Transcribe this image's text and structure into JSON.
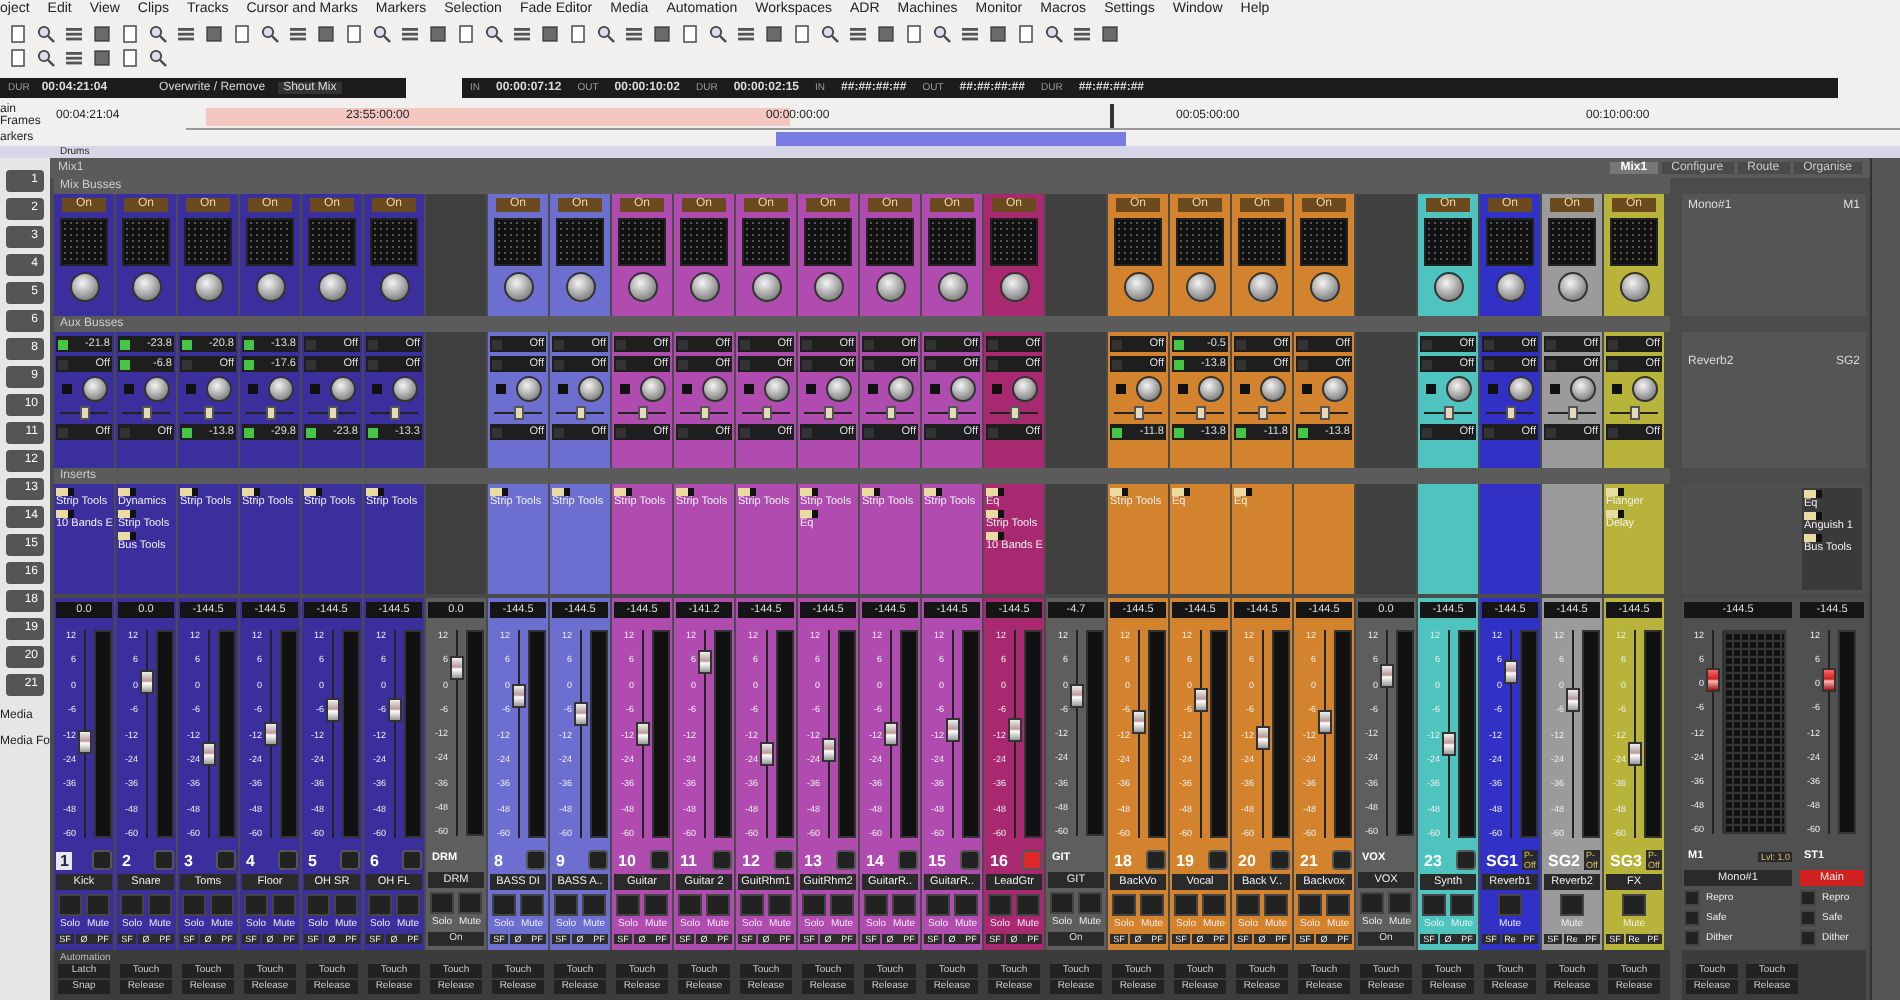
{
  "menu": [
    "oject",
    "Edit",
    "View",
    "Clips",
    "Tracks",
    "Cursor and Marks",
    "Markers",
    "Selection",
    "Fade Editor",
    "Media",
    "Automation",
    "Workspaces",
    "ADR",
    "Machines",
    "Monitor",
    "Macros",
    "Settings",
    "Window",
    "Help"
  ],
  "transport": {
    "duration_label": "DUR",
    "duration": "00:04:21:04",
    "mode": "Overwrite / Remove",
    "mix_button": "Shout Mix",
    "fields": [
      {
        "label": "IN",
        "value": "00:00:07:12"
      },
      {
        "label": "OUT",
        "value": "00:00:10:02"
      },
      {
        "label": "DUR",
        "value": "00:00:02:15"
      },
      {
        "label": "IN",
        "value": "##:##:##:##"
      },
      {
        "label": "OUT",
        "value": "##:##:##:##"
      },
      {
        "label": "DUR",
        "value": "##:##:##:##"
      }
    ]
  },
  "ruler": {
    "label": "ain Frames",
    "position": "00:04:21:04",
    "ticks": [
      "23:55:00:00",
      "00:00:00:00",
      "00:05:00:00",
      "00:10:00:00"
    ],
    "markers_label": "arkers",
    "track_label": "Drums"
  },
  "track_list": {
    "numbers": [
      "1",
      "2",
      "3",
      "4",
      "5",
      "6",
      "8",
      "9",
      "10",
      "11",
      "12",
      "13",
      "14",
      "15",
      "16",
      "18",
      "19",
      "20",
      "21"
    ],
    "media": [
      "Media",
      "Media Fo"
    ]
  },
  "mixer": {
    "title": "Mix1",
    "tabs": [
      {
        "label": "Mix1",
        "selected": true
      },
      {
        "label": "Configure",
        "selected": false
      },
      {
        "label": "Route",
        "selected": false
      },
      {
        "label": "Organise",
        "selected": false
      }
    ],
    "sections": [
      "Mix Busses",
      "Aux Busses",
      "Inserts",
      "Automation"
    ],
    "channels": [
      {
        "kind": "track",
        "number": "1",
        "name": "Kick",
        "color": "#3b2f9e",
        "selected": true,
        "armed": false,
        "bus": "On",
        "aux": [
          {
            "value": "-21.8",
            "on": true
          },
          {
            "value": "Off",
            "on": false
          },
          {
            "value": "Off",
            "on": false
          }
        ],
        "inserts": [
          "Strip Tools",
          "10 Bands E"
        ],
        "reading": "0.0",
        "level": 0.46,
        "scale": [
          "12",
          "6",
          "0",
          "-6",
          "-12",
          "-24",
          "-36",
          "-48",
          "-60"
        ],
        "buttons": [
          "Solo",
          "Mute"
        ],
        "flags": [
          "SF",
          "Ø",
          "PF"
        ],
        "auto": [
          "Latch",
          "Snap"
        ]
      },
      {
        "kind": "track",
        "number": "2",
        "name": "Snare",
        "color": "#3b2f9e",
        "selected": false,
        "armed": false,
        "bus": "On",
        "aux": [
          {
            "value": "-23.8",
            "on": true
          },
          {
            "value": "-6.8",
            "on": true
          },
          {
            "value": "Off",
            "on": false
          }
        ],
        "inserts": [
          "Dynamics",
          "Strip Tools",
          "Bus Tools"
        ],
        "reading": "0.0",
        "level": 0.75,
        "scale": [
          "12",
          "6",
          "0",
          "-6",
          "-12",
          "-24",
          "-36",
          "-48",
          "-60"
        ],
        "buttons": [
          "Solo",
          "Mute"
        ],
        "flags": [
          "SF",
          "Ø",
          "PF"
        ],
        "auto": [
          "Touch",
          "Release"
        ]
      },
      {
        "kind": "track",
        "number": "3",
        "name": "Toms",
        "color": "#3b2f9e",
        "selected": false,
        "armed": false,
        "bus": "On",
        "aux": [
          {
            "value": "-20.8",
            "on": true
          },
          {
            "value": "Off",
            "on": false
          },
          {
            "value": "-13.8",
            "on": true
          }
        ],
        "inserts": [
          "Strip Tools"
        ],
        "reading": "-144.5",
        "level": 0.4,
        "scale": [
          "12",
          "6",
          "0",
          "-6",
          "-12",
          "-24",
          "-36",
          "-48",
          "-60"
        ],
        "buttons": [
          "Solo",
          "Mute"
        ],
        "flags": [
          "SF",
          "Ø",
          "PF"
        ],
        "auto": [
          "Touch",
          "Release"
        ]
      },
      {
        "kind": "track",
        "number": "4",
        "name": "Floor",
        "color": "#3b2f9e",
        "selected": false,
        "armed": false,
        "bus": "On",
        "aux": [
          {
            "value": "-13.8",
            "on": true
          },
          {
            "value": "-17.6",
            "on": true
          },
          {
            "value": "-29.8",
            "on": true
          }
        ],
        "inserts": [
          "Strip Tools"
        ],
        "reading": "-144.5",
        "level": 0.5,
        "scale": [
          "12",
          "6",
          "0",
          "-6",
          "-12",
          "-24",
          "-36",
          "-48",
          "-60"
        ],
        "buttons": [
          "Solo",
          "Mute"
        ],
        "flags": [
          "SF",
          "Ø",
          "PF"
        ],
        "auto": [
          "Touch",
          "Release"
        ]
      },
      {
        "kind": "track",
        "number": "5",
        "name": "OH SR",
        "color": "#3b2f9e",
        "selected": false,
        "armed": false,
        "bus": "On",
        "aux": [
          {
            "value": "Off",
            "on": false
          },
          {
            "value": "Off",
            "on": false
          },
          {
            "value": "-23.8",
            "on": true
          }
        ],
        "inserts": [
          "Strip Tools"
        ],
        "reading": "-144.5",
        "level": 0.62,
        "scale": [
          "12",
          "6",
          "0",
          "-6",
          "-12",
          "-24",
          "-36",
          "-48",
          "-60"
        ],
        "buttons": [
          "Solo",
          "Mute"
        ],
        "flags": [
          "SF",
          "Ø",
          "PF"
        ],
        "auto": [
          "Touch",
          "Release"
        ]
      },
      {
        "kind": "track",
        "number": "6",
        "name": "OH FL",
        "color": "#3b2f9e",
        "selected": false,
        "armed": false,
        "bus": "On",
        "aux": [
          {
            "value": "Off",
            "on": false
          },
          {
            "value": "Off",
            "on": false
          },
          {
            "value": "-13.3",
            "on": true
          }
        ],
        "inserts": [
          "Strip Tools"
        ],
        "reading": "-144.5",
        "level": 0.62,
        "scale": [
          "12",
          "6",
          "0",
          "-6",
          "-12",
          "-24",
          "-36",
          "-48",
          "-60"
        ],
        "buttons": [
          "Solo",
          "Mute"
        ],
        "flags": [
          "SF",
          "Ø",
          "PF"
        ],
        "auto": [
          "Touch",
          "Release"
        ]
      },
      {
        "kind": "group",
        "number": "DRM",
        "name": "DRM",
        "color": "#5e5e5e",
        "selected": false,
        "reading": "0.0",
        "level": 0.82,
        "scale": [
          "12",
          "6",
          "0",
          "-6",
          "-12",
          "-24",
          "-36",
          "-48",
          "-60"
        ],
        "buttons": [
          "Solo",
          "Mute"
        ],
        "state": "On",
        "auto": [
          "Touch",
          "Release"
        ]
      },
      {
        "kind": "track",
        "number": "8",
        "name": "BASS DI",
        "color": "#6c6fd0",
        "selected": false,
        "armed": false,
        "bus": "On",
        "aux": [
          {
            "value": "Off",
            "on": false
          },
          {
            "value": "Off",
            "on": false
          },
          {
            "value": "Off",
            "on": false
          }
        ],
        "inserts": [
          "Strip Tools"
        ],
        "reading": "-144.5",
        "level": 0.68,
        "scale": [
          "12",
          "6",
          "0",
          "-6",
          "-12",
          "-24",
          "-36",
          "-48",
          "-60"
        ],
        "buttons": [
          "Solo",
          "Mute"
        ],
        "flags": [
          "SF",
          "Ø",
          "PF"
        ],
        "auto": [
          "Touch",
          "Release"
        ]
      },
      {
        "kind": "track",
        "number": "9",
        "name": "BASS A..",
        "color": "#6c6fd0",
        "selected": false,
        "armed": false,
        "bus": "On",
        "aux": [
          {
            "value": "Off",
            "on": false
          },
          {
            "value": "Off",
            "on": false
          },
          {
            "value": "Off",
            "on": false
          }
        ],
        "inserts": [
          "Strip Tools"
        ],
        "reading": "-144.5",
        "level": 0.6,
        "scale": [
          "12",
          "6",
          "0",
          "-6",
          "-12",
          "-24",
          "-36",
          "-48",
          "-60"
        ],
        "buttons": [
          "Solo",
          "Mute"
        ],
        "flags": [
          "SF",
          "Ø",
          "PF"
        ],
        "auto": [
          "Touch",
          "Release"
        ]
      },
      {
        "kind": "track",
        "number": "10",
        "name": "Guitar",
        "color": "#b04cb0",
        "selected": false,
        "armed": false,
        "bus": "On",
        "aux": [
          {
            "value": "Off",
            "on": false
          },
          {
            "value": "Off",
            "on": false
          },
          {
            "value": "Off",
            "on": false
          }
        ],
        "inserts": [
          "Strip Tools"
        ],
        "reading": "-144.5",
        "level": 0.5,
        "scale": [
          "12",
          "6",
          "0",
          "-6",
          "-12",
          "-24",
          "-36",
          "-48",
          "-60"
        ],
        "buttons": [
          "Solo",
          "Mute"
        ],
        "flags": [
          "SF",
          "Ø",
          "PF"
        ],
        "auto": [
          "Touch",
          "Release"
        ]
      },
      {
        "kind": "track",
        "number": "11",
        "name": "Guitar 2",
        "color": "#b04cb0",
        "selected": false,
        "armed": false,
        "bus": "On",
        "aux": [
          {
            "value": "Off",
            "on": false
          },
          {
            "value": "Off",
            "on": false
          },
          {
            "value": "Off",
            "on": false
          }
        ],
        "inserts": [
          "Strip Tools"
        ],
        "reading": "-141.2",
        "level": 0.85,
        "scale": [
          "12",
          "6",
          "0",
          "-6",
          "-12",
          "-24",
          "-36",
          "-48",
          "-60"
        ],
        "buttons": [
          "Solo",
          "Mute"
        ],
        "flags": [
          "SF",
          "Ø",
          "PF"
        ],
        "auto": [
          "Touch",
          "Release"
        ]
      },
      {
        "kind": "track",
        "number": "12",
        "name": "GuitRhm1",
        "color": "#b04cb0",
        "selected": false,
        "armed": false,
        "bus": "On",
        "aux": [
          {
            "value": "Off",
            "on": false
          },
          {
            "value": "Off",
            "on": false
          },
          {
            "value": "Off",
            "on": false
          }
        ],
        "inserts": [
          "Strip Tools"
        ],
        "reading": "-144.5",
        "level": 0.4,
        "scale": [
          "12",
          "6",
          "0",
          "-6",
          "-12",
          "-24",
          "-36",
          "-48",
          "-60"
        ],
        "buttons": [
          "Solo",
          "Mute"
        ],
        "flags": [
          "SF",
          "Ø",
          "PF"
        ],
        "auto": [
          "Touch",
          "Release"
        ]
      },
      {
        "kind": "track",
        "number": "13",
        "name": "GuitRhm2",
        "color": "#b04cb0",
        "selected": false,
        "armed": false,
        "bus": "On",
        "aux": [
          {
            "value": "Off",
            "on": false
          },
          {
            "value": "Off",
            "on": false
          },
          {
            "value": "Off",
            "on": false
          }
        ],
        "inserts": [
          "Strip Tools",
          "Eq"
        ],
        "reading": "-144.5",
        "level": 0.42,
        "scale": [
          "12",
          "6",
          "0",
          "-6",
          "-12",
          "-24",
          "-36",
          "-48",
          "-60"
        ],
        "buttons": [
          "Solo",
          "Mute"
        ],
        "flags": [
          "SF",
          "Ø",
          "PF"
        ],
        "auto": [
          "Touch",
          "Release"
        ]
      },
      {
        "kind": "track",
        "number": "14",
        "name": "GuitarR..",
        "color": "#b04cb0",
        "selected": false,
        "armed": false,
        "bus": "On",
        "aux": [
          {
            "value": "Off",
            "on": false
          },
          {
            "value": "Off",
            "on": false
          },
          {
            "value": "Off",
            "on": false
          }
        ],
        "inserts": [
          "Strip Tools"
        ],
        "reading": "-144.5",
        "level": 0.5,
        "scale": [
          "12",
          "6",
          "0",
          "-6",
          "-12",
          "-24",
          "-36",
          "-48",
          "-60"
        ],
        "buttons": [
          "Solo",
          "Mute"
        ],
        "flags": [
          "SF",
          "Ø",
          "PF"
        ],
        "auto": [
          "Touch",
          "Release"
        ]
      },
      {
        "kind": "track",
        "number": "15",
        "name": "GuitarR..",
        "color": "#b04cb0",
        "selected": false,
        "armed": false,
        "bus": "On",
        "aux": [
          {
            "value": "Off",
            "on": false
          },
          {
            "value": "Off",
            "on": false
          },
          {
            "value": "Off",
            "on": false
          }
        ],
        "inserts": [
          "Strip Tools"
        ],
        "reading": "-144.5",
        "level": 0.52,
        "scale": [
          "12",
          "6",
          "0",
          "-6",
          "-12",
          "-24",
          "-36",
          "-48",
          "-60"
        ],
        "buttons": [
          "Solo",
          "Mute"
        ],
        "flags": [
          "SF",
          "Ø",
          "PF"
        ],
        "auto": [
          "Touch",
          "Release"
        ]
      },
      {
        "kind": "track",
        "number": "16",
        "name": "LeadGtr",
        "color": "#a8296f",
        "selected": false,
        "armed": true,
        "bus": "On",
        "aux": [
          {
            "value": "Off",
            "on": false
          },
          {
            "value": "Off",
            "on": false
          },
          {
            "value": "Off",
            "on": false
          }
        ],
        "inserts": [
          "Eq",
          "Strip Tools",
          "10 Bands E"
        ],
        "reading": "-144.5",
        "level": 0.52,
        "scale": [
          "12",
          "6",
          "0",
          "-6",
          "-12",
          "-24",
          "-36",
          "-48",
          "-60"
        ],
        "buttons": [
          "Solo",
          "Mute"
        ],
        "flags": [
          "SF",
          "Ø",
          "PF"
        ],
        "auto": [
          "Touch",
          "Release"
        ]
      },
      {
        "kind": "group",
        "number": "GIT",
        "name": "GIT",
        "color": "#5e5e5e",
        "selected": false,
        "reading": "-4.7",
        "level": 0.68,
        "scale": [
          "12",
          "6",
          "0",
          "-6",
          "-12",
          "-24",
          "-36",
          "-48",
          "-60"
        ],
        "buttons": [
          "Solo",
          "Mute"
        ],
        "state": "On",
        "auto": [
          "Touch",
          "Release"
        ]
      },
      {
        "kind": "track",
        "number": "18",
        "name": "BackVo",
        "color": "#d3832e",
        "selected": false,
        "armed": false,
        "bus": "On",
        "aux": [
          {
            "value": "Off",
            "on": false
          },
          {
            "value": "Off",
            "on": false
          },
          {
            "value": "-11.8",
            "on": true
          }
        ],
        "inserts": [
          "Strip Tools"
        ],
        "reading": "-144.5",
        "level": 0.56,
        "scale": [
          "12",
          "6",
          "0",
          "-6",
          "-12",
          "-24",
          "-36",
          "-48",
          "-60"
        ],
        "buttons": [
          "Solo",
          "Mute"
        ],
        "flags": [
          "SF",
          "Ø",
          "PF"
        ],
        "auto": [
          "Touch",
          "Release"
        ]
      },
      {
        "kind": "track",
        "number": "19",
        "name": "Vocal",
        "color": "#d3832e",
        "selected": false,
        "armed": false,
        "bus": "On",
        "aux": [
          {
            "value": "-0.5",
            "on": true
          },
          {
            "value": "-13.8",
            "on": true
          },
          {
            "value": "-13.8",
            "on": true
          }
        ],
        "inserts": [
          "Eq"
        ],
        "reading": "-144.5",
        "level": 0.66,
        "scale": [
          "12",
          "6",
          "0",
          "-6",
          "-12",
          "-24",
          "-36",
          "-48",
          "-60"
        ],
        "buttons": [
          "Solo",
          "Mute"
        ],
        "flags": [
          "SF",
          "Ø",
          "PF"
        ],
        "auto": [
          "Touch",
          "Release"
        ]
      },
      {
        "kind": "track",
        "number": "20",
        "name": "Back V..",
        "color": "#d3832e",
        "selected": false,
        "armed": false,
        "bus": "On",
        "aux": [
          {
            "value": "Off",
            "on": false
          },
          {
            "value": "Off",
            "on": false
          },
          {
            "value": "-11.8",
            "on": true
          }
        ],
        "inserts": [
          "Eq"
        ],
        "reading": "-144.5",
        "level": 0.48,
        "scale": [
          "12",
          "6",
          "0",
          "-6",
          "-12",
          "-24",
          "-36",
          "-48",
          "-60"
        ],
        "buttons": [
          "Solo",
          "Mute"
        ],
        "flags": [
          "SF",
          "Ø",
          "PF"
        ],
        "auto": [
          "Touch",
          "Release"
        ]
      },
      {
        "kind": "track",
        "number": "21",
        "name": "Backvox",
        "color": "#d3832e",
        "selected": false,
        "armed": false,
        "bus": "On",
        "aux": [
          {
            "value": "Off",
            "on": false
          },
          {
            "value": "Off",
            "on": false
          },
          {
            "value": "-13.8",
            "on": true
          }
        ],
        "reading": "-144.5",
        "level": 0.56,
        "scale": [
          "12",
          "6",
          "0",
          "-6",
          "-12",
          "-24",
          "-36",
          "-48",
          "-60"
        ],
        "buttons": [
          "Solo",
          "Mute"
        ],
        "flags": [
          "SF",
          "Ø",
          "PF"
        ],
        "auto": [
          "Touch",
          "Release"
        ]
      },
      {
        "kind": "group",
        "number": "VOX",
        "name": "VOX",
        "color": "#5e5e5e",
        "selected": false,
        "reading": "0.0",
        "level": 0.78,
        "scale": [
          "12",
          "6",
          "0",
          "-6",
          "-12",
          "-24",
          "-36",
          "-48",
          "-60"
        ],
        "buttons": [
          "Solo",
          "Mute"
        ],
        "state": "On",
        "auto": [
          "Touch",
          "Release"
        ]
      },
      {
        "kind": "track",
        "number": "23",
        "name": "Synth",
        "color": "#4fc4bf",
        "selected": false,
        "armed": false,
        "bus": "On",
        "aux": [
          {
            "value": "Off",
            "on": false
          },
          {
            "value": "Off",
            "on": false
          },
          {
            "value": "Off",
            "on": false
          }
        ],
        "reading": "-144.5",
        "level": 0.45,
        "scale": [
          "12",
          "6",
          "0",
          "-6",
          "-12",
          "-24",
          "-36",
          "-48",
          "-60"
        ],
        "buttons": [
          "Solo",
          "Mute"
        ],
        "flags": [
          "SF",
          "Ø",
          "PF"
        ],
        "auto": [
          "Touch",
          "Release"
        ]
      },
      {
        "kind": "return",
        "number": "SG1",
        "tag": "P-Off",
        "name": "Reverb1",
        "color": "#3131c6",
        "selected": false,
        "bus": "On",
        "aux": [
          {
            "value": "Off",
            "on": false
          },
          {
            "value": "Off",
            "on": false
          },
          {
            "value": "Off",
            "on": false
          }
        ],
        "reading": "-144.5",
        "level": 0.8,
        "scale": [
          "12",
          "6",
          "0",
          "-6",
          "-12",
          "-24",
          "-36",
          "-48",
          "-60"
        ],
        "buttons": [
          "Mute"
        ],
        "flags": [
          "SF",
          "Re",
          "PF"
        ],
        "auto": [
          "Touch",
          "Release"
        ]
      },
      {
        "kind": "return",
        "number": "SG2",
        "tag": "P-Off",
        "name": "Reverb2",
        "color": "#9b9b9b",
        "selected": false,
        "bus": "On",
        "aux": [
          {
            "value": "Off",
            "on": false
          },
          {
            "value": "Off",
            "on": false
          },
          {
            "value": "Off",
            "on": false
          }
        ],
        "reading": "-144.5",
        "level": 0.66,
        "scale": [
          "12",
          "6",
          "0",
          "-6",
          "-12",
          "-24",
          "-36",
          "-48",
          "-60"
        ],
        "buttons": [
          "Mute"
        ],
        "flags": [
          "SF",
          "Re",
          "PF"
        ],
        "auto": [
          "Touch",
          "Release"
        ]
      },
      {
        "kind": "return",
        "number": "SG3",
        "tag": "P-Off",
        "name": "FX",
        "color": "#b8b33b",
        "selected": false,
        "bus": "On",
        "aux": [
          {
            "value": "Off",
            "on": false
          },
          {
            "value": "Off",
            "on": false
          },
          {
            "value": "Off",
            "on": false
          }
        ],
        "inserts": [
          "Flanger",
          "Delay"
        ],
        "reading": "-144.5",
        "level": 0.4,
        "scale": [
          "12",
          "6",
          "0",
          "-6",
          "-12",
          "-24",
          "-36",
          "-48",
          "-60"
        ],
        "buttons": [
          "Mute"
        ],
        "flags": [
          "SF",
          "Re",
          "PF"
        ],
        "auto": [
          "Touch",
          "Release"
        ]
      }
    ],
    "bus_panel": [
      {
        "name": "Mono#1",
        "id": "M1"
      },
      {
        "name": "Reverb2",
        "id": "SG2"
      }
    ],
    "master_inserts": [
      "Eq",
      "Anguish 1",
      "Bus Tools"
    ],
    "masters": [
      {
        "label": "M1",
        "name": "Mono#1",
        "highlighted": false,
        "reading": "-144.5",
        "level": 0.76,
        "level_text": "Lvl: 1.0",
        "scale": [
          "12",
          "6",
          "0",
          "-6",
          "-12",
          "-24",
          "-36",
          "-48",
          "-60"
        ],
        "options": [
          "Repro",
          "Safe",
          "Dither"
        ],
        "auto": [
          "Touch",
          "Release"
        ]
      },
      {
        "label": "ST1",
        "name": "Main",
        "highlighted": true,
        "reading": "-144.5",
        "level": 0.76,
        "scale": [
          "12",
          "6",
          "0",
          "-6",
          "-12",
          "-24",
          "-36",
          "-48",
          "-60"
        ],
        "options": [
          "Repro",
          "Safe",
          "Dither"
        ],
        "auto": [
          "Touch",
          "Release"
        ]
      }
    ]
  }
}
